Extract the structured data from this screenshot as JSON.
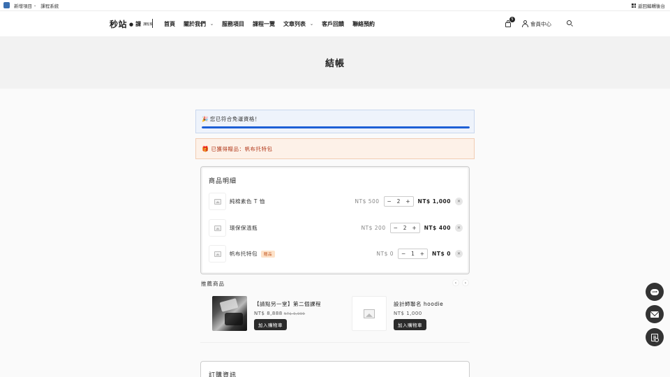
{
  "adminbar": {
    "new_item": "新增項目",
    "course_system": "課程系統",
    "back_admin": "返回編輯後台"
  },
  "header": {
    "logo_main": "秒站",
    "logo_dot": "●",
    "logo_sub": "課",
    "logo_tiny": "課程系",
    "nav": [
      {
        "label": "首頁"
      },
      {
        "label": "關於我們"
      },
      {
        "label": "服務項目"
      },
      {
        "label": "課程一覽"
      },
      {
        "label": "文章列表"
      },
      {
        "label": "客戶回饋"
      },
      {
        "label": "聯絡預約"
      }
    ],
    "cart_count": "5",
    "member_label": "會員中心"
  },
  "page": {
    "title": "結帳"
  },
  "notices": {
    "shipping_emoji": "🎉",
    "shipping_text": "您已符合免運資格！",
    "shipping_progress": 1.0,
    "gift_emoji": "🎁",
    "gift_text": "已獲得贈品：帆布托特包"
  },
  "cart": {
    "title": "商品明細",
    "items": [
      {
        "name": "純棉素色 T 恤",
        "unit_price": "NT$ 500",
        "qty": "2",
        "total": "NT$ 1,000",
        "gift": ""
      },
      {
        "name": "環保保溫瓶",
        "unit_price": "NT$ 200",
        "qty": "2",
        "total": "NT$ 400",
        "gift": ""
      },
      {
        "name": "帆布托特包",
        "unit_price": "NT$ 0",
        "qty": "1",
        "total": "NT$ 0",
        "gift": "贈品"
      }
    ],
    "minus": "−",
    "plus": "+",
    "remove": "✕"
  },
  "recommend": {
    "title": "推薦商品",
    "prev": "‹",
    "next": "›",
    "items": [
      {
        "name": "【請點另一堂】第二個課程",
        "price": "NT$ 8,888",
        "old_price": "NT$ 9,999",
        "button": "加入購物車"
      },
      {
        "name": "設計師聯名 hoodie",
        "price": "NT$ 1,000",
        "old_price": "",
        "button": "加入購物車"
      }
    ]
  },
  "order": {
    "title": "訂購資訊"
  },
  "floating": {
    "line_label": "LINE"
  }
}
